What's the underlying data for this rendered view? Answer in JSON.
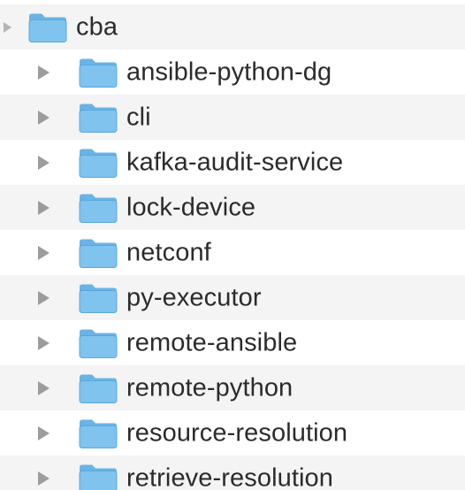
{
  "root": {
    "label": "cba",
    "icon": "folder-icon",
    "expanded": true
  },
  "children": [
    {
      "label": "ansible-python-dg",
      "icon": "folder-icon",
      "disclosure": "chevron-right-icon",
      "expanded": false
    },
    {
      "label": "cli",
      "icon": "folder-icon",
      "disclosure": "chevron-right-icon",
      "expanded": false
    },
    {
      "label": "kafka-audit-service",
      "icon": "folder-icon",
      "disclosure": "chevron-right-icon",
      "expanded": false
    },
    {
      "label": "lock-device",
      "icon": "folder-icon",
      "disclosure": "chevron-right-icon",
      "expanded": false
    },
    {
      "label": "netconf",
      "icon": "folder-icon",
      "disclosure": "chevron-right-icon",
      "expanded": false
    },
    {
      "label": "py-executor",
      "icon": "folder-icon",
      "disclosure": "chevron-right-icon",
      "expanded": false
    },
    {
      "label": "remote-ansible",
      "icon": "folder-icon",
      "disclosure": "chevron-right-icon",
      "expanded": false
    },
    {
      "label": "remote-python",
      "icon": "folder-icon",
      "disclosure": "chevron-right-icon",
      "expanded": false
    },
    {
      "label": "resource-resolution",
      "icon": "folder-icon",
      "disclosure": "chevron-right-icon",
      "expanded": false
    },
    {
      "label": "retrieve-resolution",
      "icon": "folder-icon",
      "disclosure": "chevron-right-icon",
      "expanded": false
    }
  ],
  "colors": {
    "folder_body": "#7fc3ee",
    "folder_tab": "#6ab3e4",
    "folder_edge": "#5aa8dc",
    "text": "#2b2b2b",
    "disclosure": "#9c9c9c",
    "row_alt": "#f4f4f4"
  }
}
